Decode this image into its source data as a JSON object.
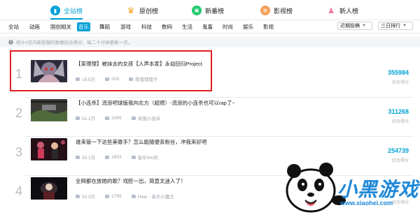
{
  "top_tabs": [
    {
      "label": "全站榜",
      "icon": "bar-chart-icon",
      "color": "#00a1d6",
      "active": true
    },
    {
      "label": "原创榜",
      "icon": "crown-icon",
      "color": "#f6a623",
      "active": false
    },
    {
      "label": "新番榜",
      "icon": "tv-icon",
      "color": "#23c96d",
      "active": false
    },
    {
      "label": "影视榜",
      "icon": "film-reel-icon",
      "color": "#f5a05a",
      "active": false
    },
    {
      "label": "新人榜",
      "icon": "new-user-icon",
      "color": "#f37aa6",
      "active": false
    }
  ],
  "categories": [
    "全站",
    "动画",
    "国创相关",
    "音乐",
    "舞蹈",
    "游戏",
    "科技",
    "数码",
    "生活",
    "鬼畜",
    "时尚",
    "娱乐",
    "影视"
  ],
  "active_category": "音乐",
  "dropdowns": {
    "type": "近期投稿",
    "range": "三日排行"
  },
  "notice": "统计3日内新投稿的数据综合得分，每二十分钟更新一次。",
  "rows": [
    {
      "rank": "1",
      "title": "【茶理理】被抹去的女孩【人声本家】永劫回归Project",
      "plays": "18.5万",
      "danmaku": "326",
      "author": "茶理理理子",
      "score": "355984",
      "score_label": "综合得分"
    },
    {
      "rank": "2",
      "title": "【小连杀】流浪吧球版我向北方（超燃）-流浪的小连杀也可以rap了~",
      "plays": "51.1万",
      "danmaku": "1069",
      "author": "米国小连杀",
      "score": "311268",
      "score_label": "综合得分"
    },
    {
      "rank": "3",
      "title": "谁来管一下这些美歌手？怎么能随便亲粉丝，冲我来好吧",
      "plays": "35.1万",
      "danmaku": "1653",
      "author": "音乐Wu讯",
      "score": "254739",
      "score_label": "综合得分"
    },
    {
      "rank": "4",
      "title": "全网都在放她的歌？戏腔一出，简直太迷人了！",
      "plays": "50.3万",
      "danmaku": "1799",
      "author": "Hear - 音乐小魔王",
      "score": "",
      "score_label": "综合得分"
    }
  ],
  "watermark": {
    "text": "小黑游戏",
    "url": "www.xiaohei.com"
  }
}
